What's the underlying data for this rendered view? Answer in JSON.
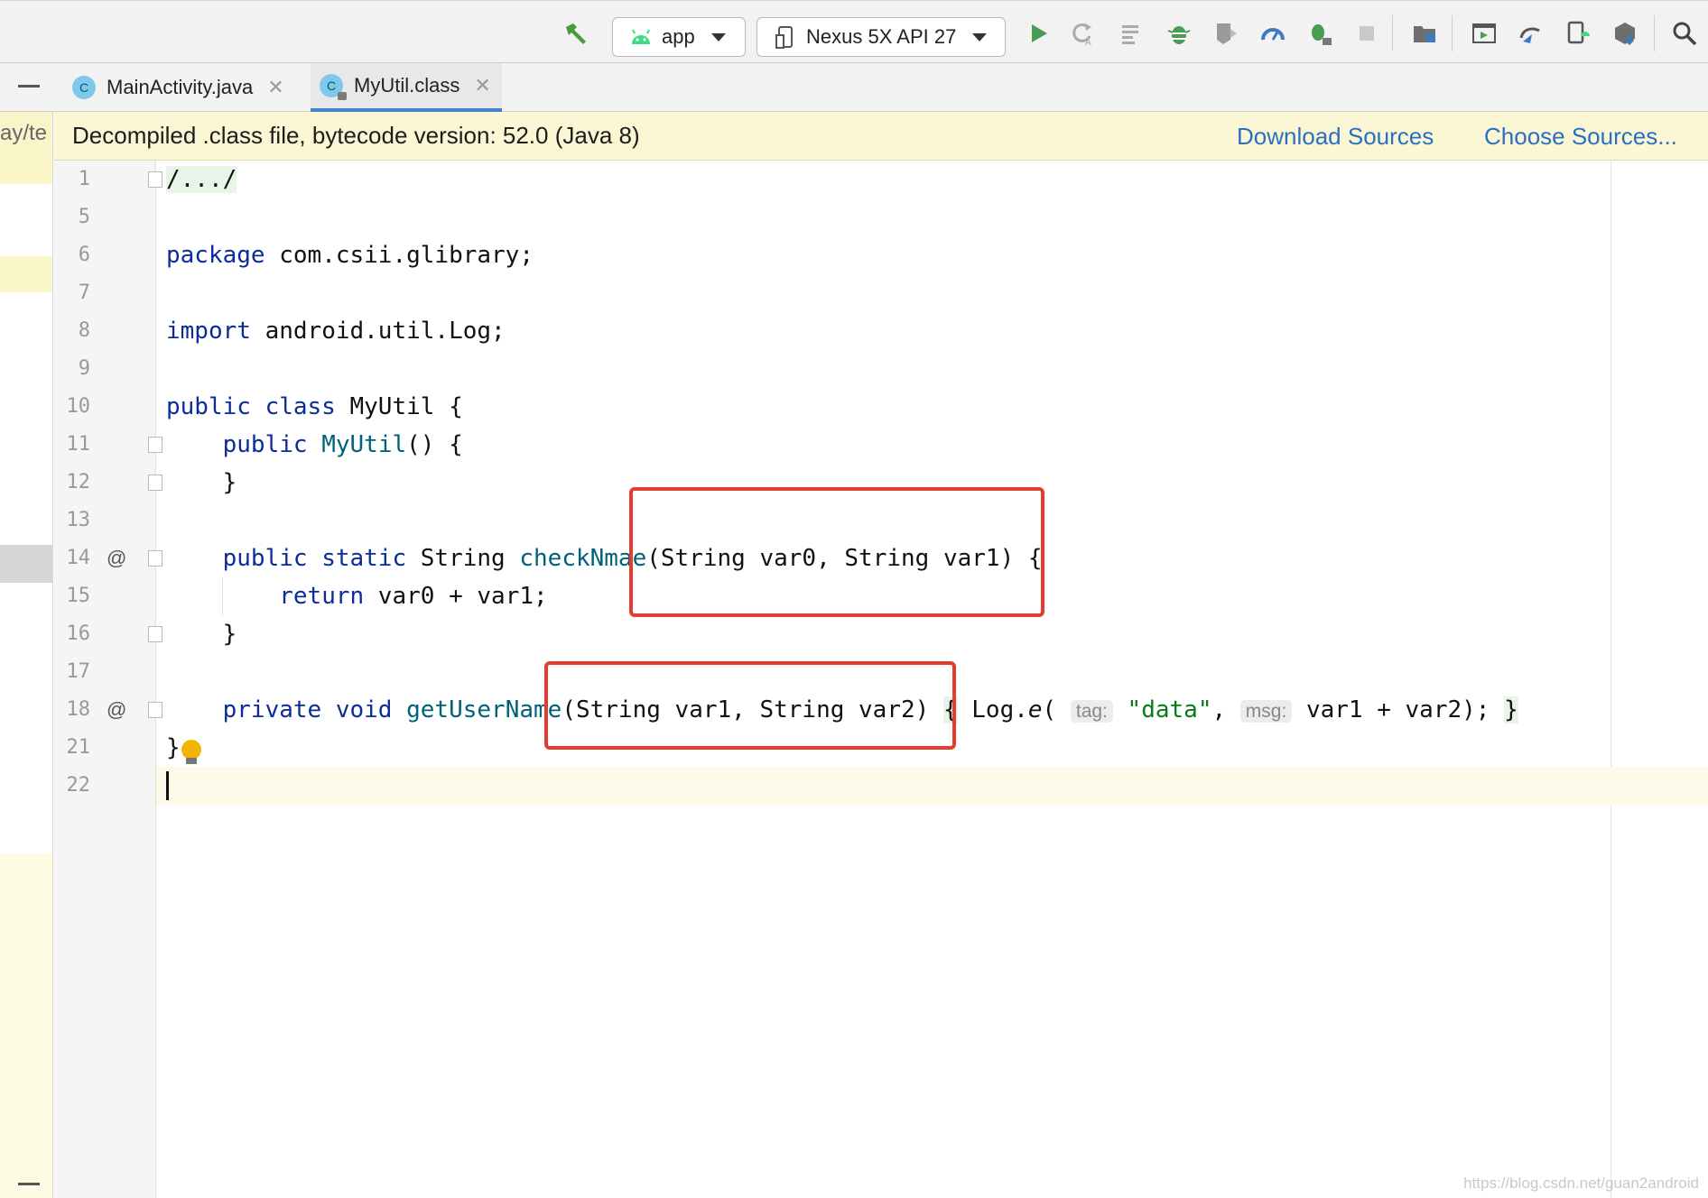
{
  "toolbar": {
    "run_config": "app",
    "device": "Nexus 5X API 27"
  },
  "tabs": [
    {
      "label": "MainActivity.java",
      "badge": "C",
      "active": false
    },
    {
      "label": "MyUtil.class",
      "badge": "C",
      "active": true
    }
  ],
  "left_strip": {
    "path_fragment": "ay/te"
  },
  "banner": {
    "message": "Decompiled .class file, bytecode version: 52.0 (Java 8)",
    "download_sources": "Download Sources",
    "choose_sources": "Choose Sources..."
  },
  "editor": {
    "line_numbers": [
      "1",
      "5",
      "6",
      "7",
      "8",
      "9",
      "10",
      "11",
      "12",
      "13",
      "14",
      "15",
      "16",
      "17",
      "18",
      "21",
      "22"
    ],
    "lines": {
      "l1": "/.../",
      "l6_kw": "package",
      "l6_rest": " com.csii.glibrary;",
      "l8_kw": "import",
      "l8_rest": " android.util.Log;",
      "l10_kw": "public class",
      "l10_rest": " MyUtil {",
      "l11_kw": "public",
      "l11_fn": "MyUtil",
      "l11_rest": "() {",
      "l12": "}",
      "l14_kw": "public static",
      "l14_type": " String ",
      "l14_fn": "checkNmae",
      "l14_rest": "(String var0, String var1) {",
      "l15_kw": "return",
      "l15_rest": " var0 + var1;",
      "l16": "}",
      "l18_kw": "private void",
      "l18_fn": "getUserName",
      "l18_params": "(String var1, String var2) ",
      "l18_open": "{",
      "l18_call": " Log.",
      "l18_method": "e",
      "l18_paren": "( ",
      "l18_tag_hint": "tag:",
      "l18_str": "\"data\"",
      "l18_comma": ", ",
      "l18_msg_hint": "msg:",
      "l18_tail": " var1 + var2); ",
      "l18_close": "}",
      "l21": "}"
    },
    "override_marker": "@"
  },
  "watermark": "https://blog.csdn.net/guan2android",
  "colors": {
    "keyword": "#0b2d9c",
    "function": "#00627a",
    "string": "#067d17",
    "annotation_box": "#e23d2d",
    "link": "#2a70c2",
    "banner_bg": "#fbf6d3"
  }
}
